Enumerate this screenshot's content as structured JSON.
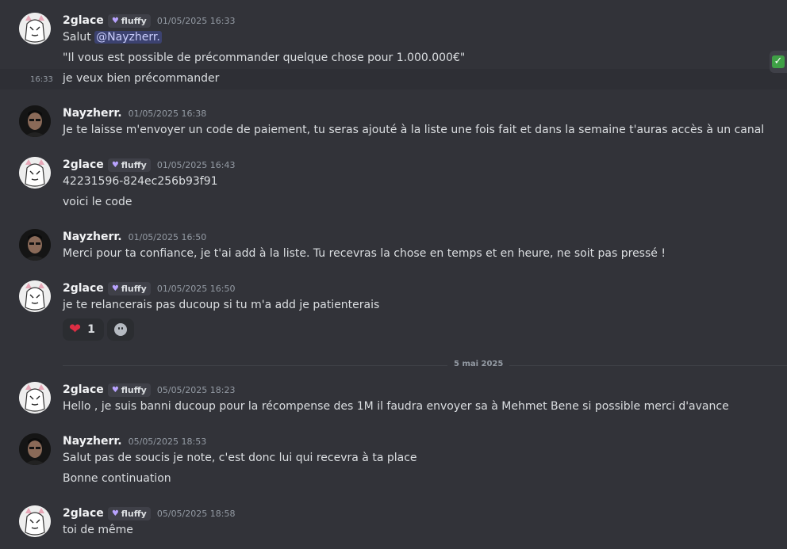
{
  "hover_time": "16:33",
  "date_divider": "5 mai 2025",
  "reaction": {
    "count": "1"
  },
  "messages": [
    {
      "user": "2glace",
      "tag": "fluffy",
      "time": "01/05/2025 16:33",
      "mention": "@Nayzherr.",
      "salut": "Salut",
      "line2": "\"Il vous est possible de précommander quelque chose pour 1.000.000€\"",
      "line3": "je veux bien précommander"
    },
    {
      "user": "Nayzherr.",
      "time": "01/05/2025 16:38",
      "line1": "Je te laisse m'envoyer un code de paiement, tu seras ajouté à la liste une fois fait et dans la semaine t'auras accès à un canal"
    },
    {
      "user": "2glace",
      "tag": "fluffy",
      "time": "01/05/2025 16:43",
      "line1": "42231596-824ec256b93f91",
      "line2": "voici le code"
    },
    {
      "user": "Nayzherr.",
      "time": "01/05/2025 16:50",
      "line1": "Merci pour ta confiance, je t'ai add à la liste. Tu recevras la chose en temps et en heure, ne soit pas pressé !"
    },
    {
      "user": "2glace",
      "tag": "fluffy",
      "time": "01/05/2025 16:50",
      "line1": "je te relancerais pas ducoup si tu m'a add je patienterais"
    },
    {
      "user": "2glace",
      "tag": "fluffy",
      "time": "05/05/2025 18:23",
      "line1": "Hello , je suis banni ducoup pour la récompense des 1M il faudra envoyer sa à Mehmet Bene si possible merci d'avance"
    },
    {
      "user": "Nayzherr.",
      "time": "05/05/2025 18:53",
      "line1": "Salut pas de soucis je note, c'est donc lui qui recevra à ta place",
      "line2": "Bonne continuation"
    },
    {
      "user": "2glace",
      "tag": "fluffy",
      "time": "05/05/2025 18:58",
      "line1": "toi de même"
    }
  ]
}
